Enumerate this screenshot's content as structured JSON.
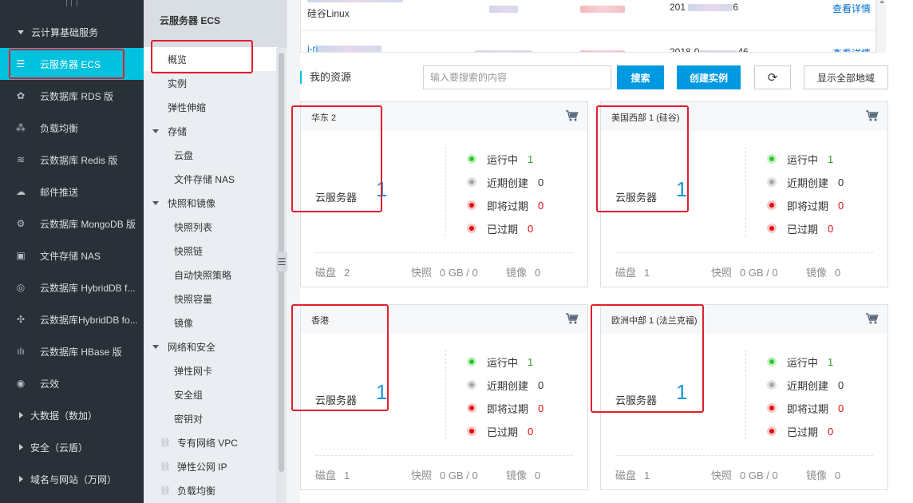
{
  "sidebar": {
    "groups": [
      {
        "label": "云计算基础服务",
        "expanded": true
      },
      {
        "label": "大数据（数加）",
        "expanded": false
      },
      {
        "label": "安全（云盾）",
        "expanded": false
      },
      {
        "label": "域名与网站（万网）",
        "expanded": false
      }
    ],
    "items": [
      {
        "label": "云服务器 ECS",
        "icon": "server-icon",
        "glyph": "☰",
        "active": true
      },
      {
        "label": "云数据库 RDS 版",
        "icon": "rds-icon",
        "glyph": "✿",
        "active": false
      },
      {
        "label": "负载均衡",
        "icon": "load-balancer-icon",
        "glyph": "⁂",
        "active": false
      },
      {
        "label": "云数据库 Redis 版",
        "icon": "redis-icon",
        "glyph": "≋",
        "active": false
      },
      {
        "label": "邮件推送",
        "icon": "mail-push-icon",
        "glyph": "☁",
        "active": false
      },
      {
        "label": "云数据库 MongoDB 版",
        "icon": "mongodb-icon",
        "glyph": "⚙",
        "active": false
      },
      {
        "label": "文件存储 NAS",
        "icon": "nas-icon",
        "glyph": "▣",
        "active": false
      },
      {
        "label": "云数据库 HybridDB f...",
        "icon": "hybriddb-icon",
        "glyph": "◎",
        "active": false
      },
      {
        "label": "云数据库HybridDB fo...",
        "icon": "hybriddb-2-icon",
        "glyph": "✣",
        "active": false
      },
      {
        "label": "云数据库 HBase 版",
        "icon": "hbase-icon",
        "glyph": "ılı",
        "active": false
      },
      {
        "label": "云效",
        "icon": "yunxiao-icon",
        "glyph": "◉",
        "active": false
      }
    ]
  },
  "subnav": {
    "title": "云服务器 ECS",
    "items": [
      {
        "label": "概览",
        "kind": "lv1",
        "active": true
      },
      {
        "label": "实例",
        "kind": "lv1"
      },
      {
        "label": "弹性伸缩",
        "kind": "lv1"
      },
      {
        "label": "存储",
        "kind": "grp"
      },
      {
        "label": "云盘",
        "kind": "lv2"
      },
      {
        "label": "文件存储 NAS",
        "kind": "lv2"
      },
      {
        "label": "快照和镜像",
        "kind": "grp"
      },
      {
        "label": "快照列表",
        "kind": "lv2"
      },
      {
        "label": "快照链",
        "kind": "lv2"
      },
      {
        "label": "自动快照策略",
        "kind": "lv2"
      },
      {
        "label": "快照容量",
        "kind": "lv2"
      },
      {
        "label": "镜像",
        "kind": "lv2"
      },
      {
        "label": "网络和安全",
        "kind": "grp"
      },
      {
        "label": "弹性网卡",
        "kind": "lv2"
      },
      {
        "label": "安全组",
        "kind": "lv2"
      },
      {
        "label": "密钥对",
        "kind": "lv2"
      },
      {
        "label": "专有网络 VPC",
        "kind": "link"
      },
      {
        "label": "弹性公网 IP",
        "kind": "link"
      },
      {
        "label": "负载均衡",
        "kind": "link"
      }
    ]
  },
  "top_table": {
    "rows": [
      {
        "name_sub": "硅谷Linux",
        "date_prefix": "201",
        "date_suffix": "6",
        "action": "查看详情"
      },
      {
        "name_prefix": "i-rj",
        "date_prefix": "2018-0",
        "date_suffix": "46",
        "action": "查看详情"
      }
    ]
  },
  "resources": {
    "title": "我的资源",
    "search_placeholder": "输入要搜索的内容",
    "search_label": "搜索",
    "create_label": "创建实例",
    "region_label": "显示全部地域"
  },
  "card_labels": {
    "servers": "云服务器",
    "running": "运行中",
    "recent": "近期创建",
    "expiring": "即将过期",
    "expired": "已过期",
    "disk": "磁盘",
    "snapshot": "快照",
    "image": "镜像"
  },
  "regions": [
    {
      "name": "华东 2",
      "servers": 1,
      "running": 1,
      "recent": 0,
      "expiring": 0,
      "expired": 0,
      "disk": 2,
      "snapshot": "0 GB / 0",
      "image": 0
    },
    {
      "name": "美国西部 1 (硅谷)",
      "servers": 1,
      "running": 1,
      "recent": 0,
      "expiring": 0,
      "expired": 0,
      "disk": 1,
      "snapshot": "0 GB / 0",
      "image": 0
    },
    {
      "name": "香港",
      "servers": 1,
      "running": 1,
      "recent": 0,
      "expiring": 0,
      "expired": 0,
      "disk": 1,
      "snapshot": "0 GB / 0",
      "image": 0
    },
    {
      "name": "欧洲中部 1 (法兰克福)",
      "servers": 1,
      "running": 1,
      "recent": 0,
      "expiring": 0,
      "expired": 0,
      "disk": 1,
      "snapshot": "0 GB / 0",
      "image": 0
    }
  ],
  "colors": {
    "sidebar_bg": "#293038",
    "accent": "#00c1de",
    "primary_button": "#0099e1",
    "count_blue": "#1897d9",
    "highlight_red": "#e11f2e"
  }
}
